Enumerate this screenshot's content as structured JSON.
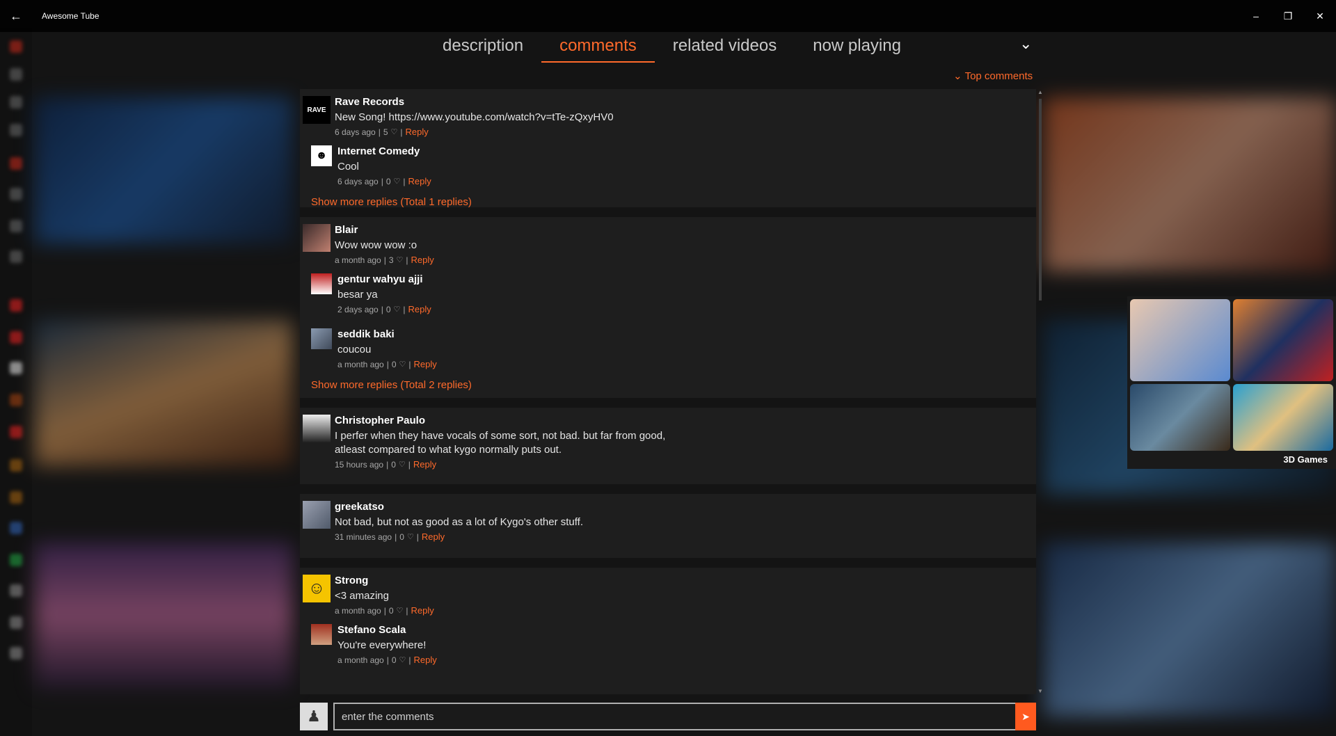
{
  "window": {
    "title": "Awesome Tube",
    "back_icon": "arrow-left-icon",
    "minimize_icon": "minimize-icon",
    "maximize_icon": "restore-icon",
    "close_icon": "close-icon"
  },
  "tabs": [
    {
      "label": "description",
      "active": false
    },
    {
      "label": "comments",
      "active": true
    },
    {
      "label": "related videos",
      "active": false
    },
    {
      "label": "now playing",
      "active": false
    }
  ],
  "sort": {
    "label": "Top comments",
    "icon": "chevron-down-icon"
  },
  "accent_color": "#ff6a2b",
  "threads": [
    {
      "author": "Rave Records",
      "avatar_text": "RAVE",
      "text": "New Song! https://www.youtube.com/watch?v=tTe-zQxyHV0",
      "time": "6 days ago",
      "likes": "5",
      "reply_label": "Reply",
      "replies": [
        {
          "author": "Internet Comedy",
          "text": "Cool",
          "time": "6 days ago",
          "likes": "0",
          "reply_label": "Reply"
        }
      ],
      "more_label": "Show more replies (Total 1 replies)"
    },
    {
      "author": "Blair",
      "text": "Wow wow wow :o",
      "time": "a month ago",
      "likes": "3",
      "reply_label": "Reply",
      "replies": [
        {
          "author": "gentur wahyu ajji",
          "text": "besar ya",
          "time": "2 days ago",
          "likes": "0",
          "reply_label": "Reply"
        },
        {
          "author": "seddik baki",
          "text": "coucou",
          "time": "a month ago",
          "likes": "0",
          "reply_label": "Reply"
        }
      ],
      "more_label": "Show more replies (Total 2 replies)"
    },
    {
      "author": "Christopher Paulo",
      "text_line1": "I perfer when they have vocals of some sort, not bad. but far from good,",
      "text_line2": "atleast compared to what kygo normally puts out.",
      "time": "15 hours ago",
      "likes": "0",
      "reply_label": "Reply"
    },
    {
      "author": "greekatso",
      "text": "Not bad, but not as good as a lot of Kygo's other stuff.",
      "time": "31 minutes ago",
      "likes": "0",
      "reply_label": "Reply"
    },
    {
      "author": "Strong",
      "text": "<3 amazing",
      "time": "a month ago",
      "likes": "0",
      "reply_label": "Reply",
      "replies": [
        {
          "author": "Stefano Scala",
          "text": "You're everywhere!",
          "time": "a month ago",
          "likes": "0",
          "reply_label": "Reply"
        }
      ]
    }
  ],
  "comment_box": {
    "placeholder": "enter the comments",
    "send_icon": "send-icon"
  },
  "ad": {
    "label": "3D Games"
  }
}
